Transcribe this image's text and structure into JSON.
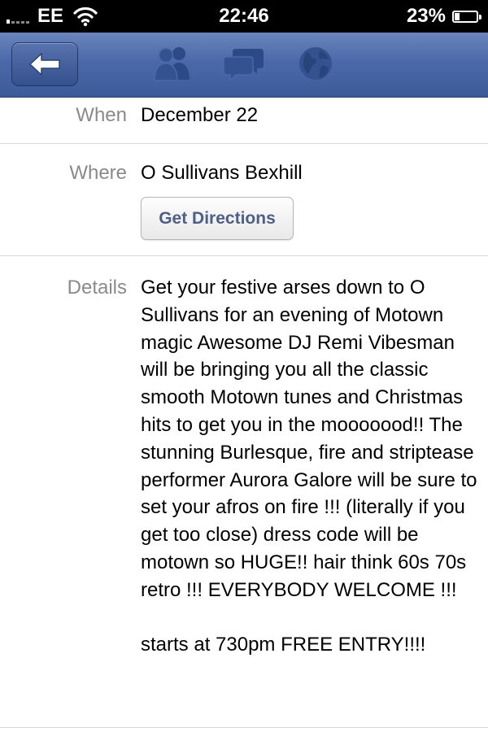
{
  "status_bar": {
    "carrier": "EE",
    "time": "22:46",
    "battery_percent_label": "23%",
    "battery_level": 0.23
  },
  "nav_bar": {
    "back_icon": "back-arrow-icon",
    "icons": [
      "friends-icon",
      "messages-icon",
      "globe-icon"
    ],
    "accent_color": "#4b69a9"
  },
  "event": {
    "when_label": "When",
    "when_value": "December 22",
    "where_label": "Where",
    "where_value": "O Sullivans Bexhill",
    "directions_label": "Get Directions",
    "details_label": "Details",
    "details_text": "Get your festive arses down to O Sullivans for an evening of Motown magic Awesome DJ Remi Vibesman will be bringing you all the classic smooth Motown tunes and Christmas hits to get you in the mooooood!! The stunning Burlesque, fire and striptease performer Aurora Galore will be sure to set your afros on fire !!! (literally if you get too close) dress code will be motown so HUGE!! hair think 60s 70s retro !!! EVERYBODY WELCOME !!!\n\nstarts at 730pm FREE ENTRY!!!!"
  }
}
